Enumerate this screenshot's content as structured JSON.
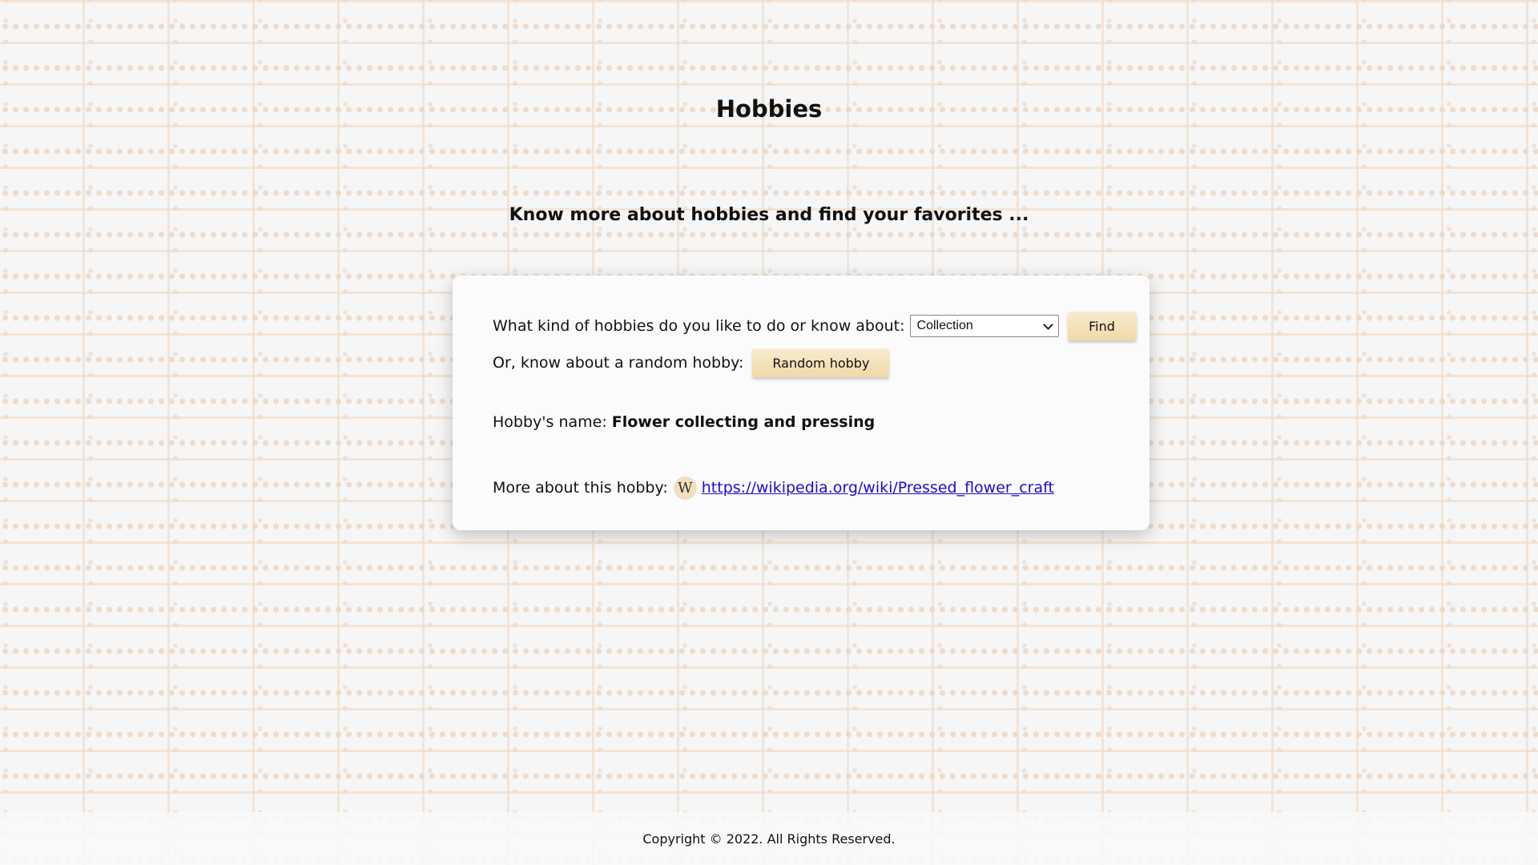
{
  "header": {
    "title": "Hobbies",
    "tagline": "Know more about hobbies and find your favorites ..."
  },
  "search": {
    "question_label": "What kind of hobbies do you like to do or know about:",
    "category_selected": "Collection",
    "find_label": "Find",
    "random_label_text": "Or, know about a random hobby:",
    "random_button_label": "Random hobby"
  },
  "result": {
    "name_label": "Hobby's name:",
    "name_value": "Flower collecting and pressing",
    "more_label": "More about this hobby:",
    "wiki_icon_glyph": "W",
    "wiki_link": "https://wikipedia.org/wiki/Pressed_flower_craft"
  },
  "footer": {
    "copyright": "Copyright © 2022. All Rights Reserved."
  },
  "colors": {
    "button_gradient_top": "#f7ebd0",
    "button_gradient_bottom": "#f2d9a6",
    "link": "#1a0dcc",
    "wiki_badge_bg": "#f1dfc0",
    "card_bg": "#fbfbfb"
  },
  "icons": {
    "wiki": "wikipedia-icon",
    "dropdown": "chevron-down-icon"
  }
}
